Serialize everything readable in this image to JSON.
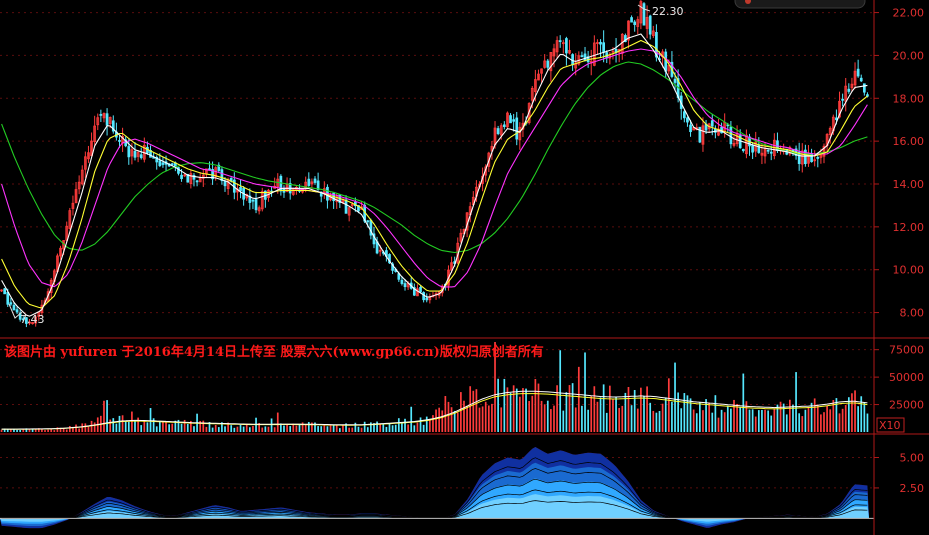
{
  "chart_data": [
    {
      "type": "candlestick",
      "y_ticks": [
        "22.00",
        "20.00",
        "18.00",
        "16.00",
        "14.00",
        "12.00",
        "10.00",
        "8.00"
      ],
      "ylim": [
        7.0,
        22.4
      ],
      "annotations": {
        "low": "7.43",
        "high": "22.30"
      },
      "anchors": {
        "price": [
          9.0,
          8.0,
          7.43,
          8.2,
          10.0,
          12.5,
          14.8,
          16.8,
          17.0,
          16.0,
          15.3,
          15.6,
          15.0,
          14.6,
          14.2,
          14.4,
          14.6,
          14.1,
          13.4,
          13.0,
          13.6,
          14.0,
          13.8,
          13.9,
          13.7,
          13.2,
          12.9,
          12.7,
          11.2,
          10.3,
          9.6,
          9.0,
          8.5,
          8.9,
          10.5,
          12.5,
          14.5,
          16.3,
          17.0,
          16.2,
          18.5,
          19.8,
          20.6,
          19.5,
          20.1,
          20.3,
          20.5,
          21.2,
          22.3,
          20.6,
          19.3,
          17.6,
          16.3,
          16.4,
          16.8,
          16.0,
          15.9,
          15.6,
          15.8,
          15.5,
          15.2,
          15.3,
          16.0,
          18.0,
          19.0,
          18.5
        ],
        "ma5": [
          9.5,
          8.4,
          7.8,
          8.1,
          9.5,
          11.5,
          13.5,
          15.8,
          16.8,
          16.2,
          15.6,
          15.4,
          15.1,
          14.8,
          14.4,
          14.3,
          14.3,
          14.1,
          13.6,
          13.3,
          13.5,
          13.8,
          13.8,
          13.8,
          13.6,
          13.3,
          13.0,
          12.6,
          11.5,
          10.5,
          9.7,
          9.1,
          8.7,
          8.9,
          10.2,
          12.2,
          14.1,
          15.8,
          16.6,
          16.4,
          18.0,
          19.3,
          20.1,
          19.7,
          19.9,
          20.1,
          20.3,
          20.8,
          21.0,
          20.2,
          19.1,
          17.8,
          16.6,
          16.4,
          16.5,
          16.1,
          15.9,
          15.7,
          15.6,
          15.5,
          15.3,
          15.3,
          15.8,
          17.4,
          18.5,
          18.6
        ],
        "ma10": [
          10.5,
          9.2,
          8.4,
          8.2,
          8.8,
          10.3,
          12.3,
          14.6,
          16.1,
          16.4,
          15.9,
          15.6,
          15.3,
          15.0,
          14.7,
          14.5,
          14.4,
          14.2,
          13.9,
          13.6,
          13.6,
          13.7,
          13.7,
          13.7,
          13.6,
          13.4,
          13.2,
          12.9,
          12.1,
          11.1,
          10.2,
          9.5,
          9.0,
          9.0,
          9.8,
          11.3,
          13.2,
          15.0,
          16.1,
          16.5,
          17.4,
          18.5,
          19.4,
          19.6,
          19.8,
          19.9,
          20.1,
          20.4,
          20.7,
          20.4,
          19.7,
          18.6,
          17.4,
          16.7,
          16.5,
          16.3,
          16.0,
          15.8,
          15.7,
          15.6,
          15.4,
          15.3,
          15.5,
          16.5,
          17.6,
          18.1
        ],
        "ma20": [
          14.0,
          12.0,
          10.3,
          9.4,
          9.2,
          9.8,
          11.2,
          13.0,
          14.8,
          15.9,
          16.1,
          15.9,
          15.6,
          15.3,
          15.0,
          14.7,
          14.6,
          14.4,
          14.2,
          14.0,
          13.9,
          13.8,
          13.8,
          13.7,
          13.6,
          13.5,
          13.3,
          13.1,
          12.6,
          11.9,
          11.1,
          10.3,
          9.6,
          9.2,
          9.2,
          9.9,
          11.2,
          12.9,
          14.5,
          15.6,
          16.6,
          17.6,
          18.6,
          19.2,
          19.6,
          19.8,
          20.0,
          20.2,
          20.3,
          20.2,
          19.8,
          19.0,
          18.0,
          17.2,
          16.7,
          16.4,
          16.2,
          16.0,
          15.8,
          15.7,
          15.5,
          15.4,
          15.4,
          15.8,
          16.7,
          17.7
        ],
        "ma60": [
          16.8,
          15.2,
          13.8,
          12.6,
          11.6,
          11.0,
          10.9,
          11.2,
          11.8,
          12.6,
          13.4,
          14.0,
          14.5,
          14.8,
          14.95,
          15.0,
          14.9,
          14.7,
          14.5,
          14.3,
          14.15,
          14.05,
          13.95,
          13.85,
          13.75,
          13.6,
          13.4,
          13.2,
          12.9,
          12.5,
          12.1,
          11.6,
          11.2,
          10.9,
          10.8,
          10.9,
          11.2,
          11.7,
          12.4,
          13.3,
          14.4,
          15.6,
          16.7,
          17.7,
          18.5,
          19.1,
          19.5,
          19.7,
          19.6,
          19.3,
          18.9,
          18.4,
          17.9,
          17.4,
          17.0,
          16.6,
          16.2,
          15.9,
          15.7,
          15.5,
          15.4,
          15.4,
          15.5,
          15.7,
          16.0,
          16.2
        ]
      }
    },
    {
      "type": "bar",
      "y_ticks": [
        "75000",
        "50000",
        "25000"
      ],
      "ylim": [
        0,
        82000
      ],
      "multiplier_label": "X10",
      "anchors": {
        "volume": [
          3000,
          2800,
          2600,
          2500,
          2800,
          4000,
          6000,
          9000,
          12000,
          11000,
          9500,
          9000,
          8500,
          8000,
          7500,
          7200,
          7000,
          6800,
          6600,
          6500,
          6700,
          7000,
          6800,
          6500,
          6200,
          6000,
          6100,
          6500,
          7500,
          8500,
          9000,
          10000,
          12000,
          16000,
          22000,
          30000,
          36000,
          38000,
          37000,
          36000,
          35000,
          34000,
          33000,
          32000,
          31000,
          30000,
          30000,
          31000,
          32000,
          30000,
          28000,
          26000,
          25000,
          24000,
          23000,
          22000,
          21000,
          21000,
          21000,
          22000,
          22000,
          23000,
          25000,
          28000,
          27000,
          24000
        ],
        "vol_ma": [
          2500,
          2500,
          2600,
          2700,
          2900,
          3500,
          4500,
          6000,
          8000,
          9500,
          10000,
          9800,
          9300,
          8800,
          8200,
          7800,
          7500,
          7200,
          6900,
          6700,
          6700,
          6800,
          6800,
          6700,
          6500,
          6300,
          6200,
          6300,
          6800,
          7500,
          8200,
          9000,
          10500,
          13000,
          17000,
          22500,
          28000,
          32000,
          34000,
          35000,
          35000,
          34500,
          33500,
          32500,
          31500,
          30500,
          30000,
          30500,
          31000,
          30500,
          29000,
          27500,
          26000,
          25000,
          24000,
          23000,
          22000,
          21500,
          21000,
          21500,
          22000,
          22500,
          24000,
          26000,
          26500,
          25000
        ]
      }
    },
    {
      "type": "area",
      "y_ticks": [
        "5.00",
        "2.50"
      ],
      "ylim": [
        -1.2,
        6.6
      ],
      "anchors": {
        "indicator": [
          -0.6,
          -0.7,
          -0.8,
          -0.8,
          -0.5,
          -0.1,
          0.5,
          1.2,
          1.8,
          1.5,
          1.0,
          0.6,
          0.3,
          0.2,
          0.5,
          0.8,
          1.1,
          0.9,
          0.6,
          0.7,
          0.8,
          0.9,
          0.7,
          0.5,
          0.4,
          0.3,
          0.3,
          0.4,
          0.4,
          0.3,
          0.2,
          0.1,
          0.0,
          0.0,
          0.3,
          1.6,
          3.5,
          4.5,
          5.0,
          4.8,
          5.9,
          5.3,
          5.6,
          5.2,
          5.4,
          5.3,
          4.4,
          3.1,
          1.5,
          0.6,
          0.2,
          -0.2,
          -0.5,
          -0.8,
          -0.5,
          -0.3,
          0.0,
          0.1,
          0.2,
          0.3,
          0.2,
          0.1,
          0.4,
          1.2,
          2.8,
          2.7
        ]
      }
    }
  ],
  "watermark": "该图片由 yufuren 于2016年4月14日上传至 股票六六(www.gp66.cn)版权归原创者所有",
  "colors": {
    "background": "#000000",
    "frame": "#b01818",
    "axis_text": "#e03030",
    "candle_up": "#ff3c3c",
    "candle_down": "#55e8ff",
    "ma5": "#ffffff",
    "ma10": "#ffff33",
    "ma20": "#ff33ff",
    "ma60": "#22cc22",
    "watermark": "#ff1a1a"
  }
}
